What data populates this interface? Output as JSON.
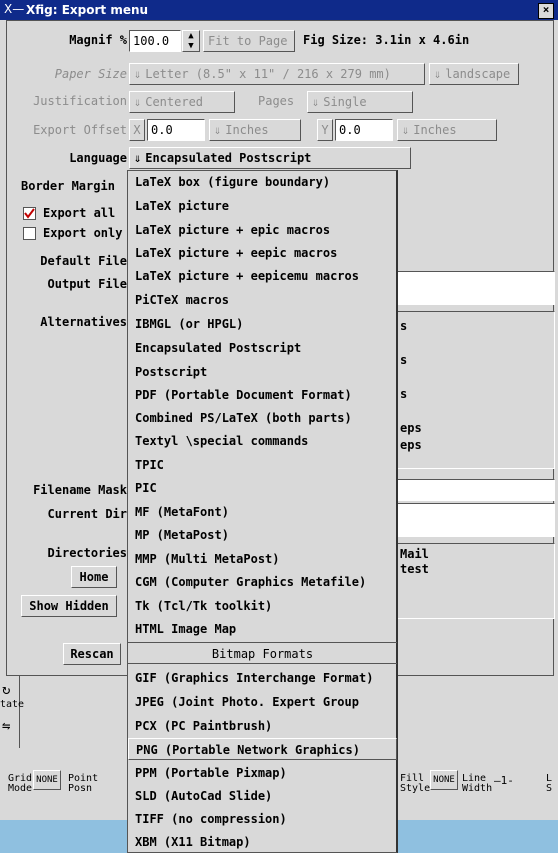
{
  "window": {
    "title": "Xfig: Export menu",
    "menu_glyph": "X—",
    "close_glyph": "×"
  },
  "form": {
    "magnif_label": "Magnif %",
    "magnif_value": "100.0",
    "fit_to_page": "Fit to Page",
    "fig_size": "Fig Size: 3.1in x 4.6in",
    "paper_size_label": "Paper Size",
    "paper_size_value": "Letter  (8.5\" x 11\" / 216 x 279 mm)",
    "orientation_value": "landscape",
    "justification_label": "Justification",
    "justification_value": "Centered",
    "pages_label": "Pages",
    "pages_value": "Single",
    "export_offset_label": "Export Offset",
    "offset_x_label": "X",
    "offset_x_value": "0.0",
    "offset_x_unit": "Inches",
    "offset_y_label": "Y",
    "offset_y_value": "0.0",
    "offset_y_unit": "Inches",
    "language_label": "Language",
    "language_value": "Encapsulated Postscript",
    "border_margin_label": "Border Margin",
    "export_all_label": "Export all",
    "export_only_label": "Export only",
    "default_file_label": "Default File",
    "output_file_label": "Output File",
    "alternatives_label": "Alternatives",
    "alternatives_visible": [
      "s",
      "",
      "s",
      "",
      "s",
      "",
      "eps",
      "eps"
    ],
    "filename_mask_label": "Filename Mask",
    "current_dir_label": "Current Dir",
    "directories_label": "Directories",
    "directories_visible": [
      "Mail",
      "test"
    ],
    "home_button": "Home",
    "show_hidden_button": "Show Hidden",
    "rescan_button": "Rescan"
  },
  "dropdown": {
    "items": [
      "LaTeX box (figure boundary)",
      "LaTeX picture",
      "LaTeX picture + epic macros",
      "LaTeX picture + eepic macros",
      "LaTeX picture + eepicemu macros",
      "PiCTeX macros",
      "IBMGL (or HPGL)",
      "Encapsulated Postscript",
      "Postscript",
      "PDF (Portable Document Format)",
      "Combined PS/LaTeX (both parts)",
      "Textyl \\special commands",
      "TPIC",
      "PIC",
      "MF  (MetaFont)",
      "MP  (MetaPost)",
      "MMP (Multi MetaPost)",
      "CGM (Computer Graphics Metafile)",
      "Tk  (Tcl/Tk toolkit)",
      "HTML Image Map"
    ],
    "bitmap_header": "Bitmap Formats",
    "bitmap_items": [
      "GIF  (Graphics Interchange Format)",
      "JPEG (Joint Photo. Expert Group",
      "PCX  (PC Paintbrush)",
      "PNG  (Portable Network Graphics)",
      "PPM  (Portable Pixmap)",
      "SLD  (AutoCad Slide)",
      "TIFF (no compression)",
      "XBM  (X11 Bitmap)"
    ],
    "highlighted": "PNG  (Portable Network Graphics)"
  },
  "bottom": {
    "rotate_label": "tate",
    "grid_mode_label": "Grid\nMode",
    "grid_mode_value": "NONE",
    "point_posn_label": "Point\nPosn",
    "fill_style_label": "Fill\nStyle",
    "fill_style_value": "NONE",
    "line_width_label": "Line\nWidth",
    "line_width_value": "1",
    "edge_label": "L\nS"
  }
}
